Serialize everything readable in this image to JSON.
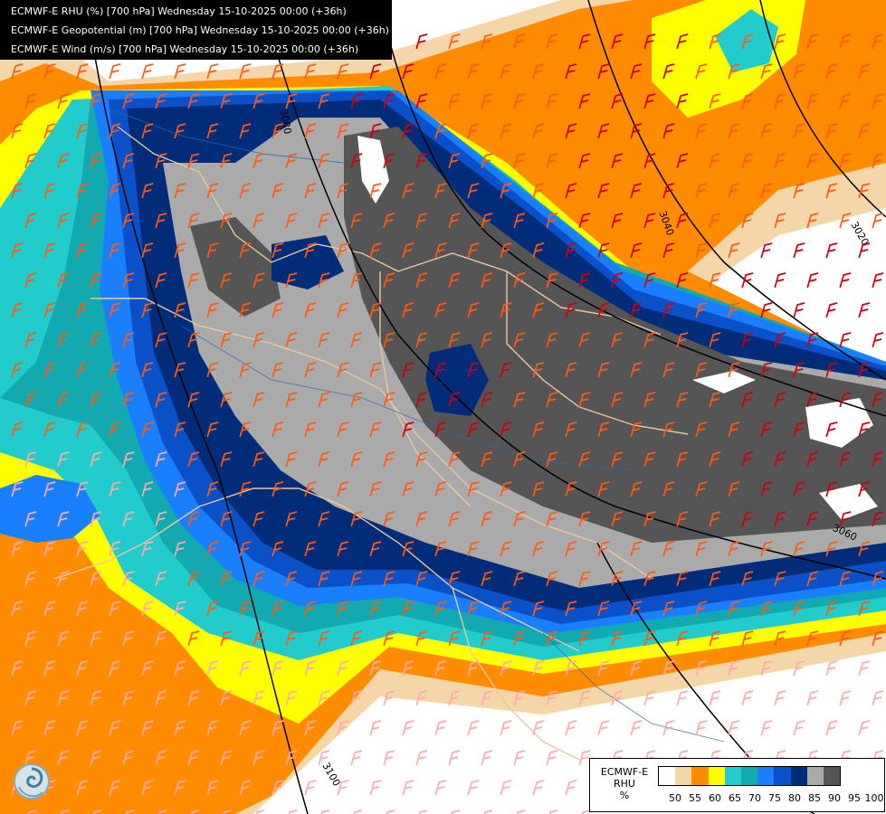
{
  "header": {
    "lines": [
      "ECMWF-E RHU (%) [700 hPa] Wednesday 15-10-2025 00:00 (+36h)",
      "ECMWF-E Geopotential (m) [700 hPa] Wednesday 15-10-2025 00:00 (+36h)",
      "ECMWF-E Wind (m/s) [700 hPa] Wednesday 15-10-2025 00:00 (+36h)"
    ]
  },
  "legend": {
    "model": "ECMWF-E",
    "variable": "RHU",
    "unit": "%",
    "colors": [
      "#ffffff",
      "#f5d6a8",
      "#ff8c00",
      "#ffff00",
      "#22cccc",
      "#10aab0",
      "#1a7fff",
      "#0a50c8",
      "#002c7a",
      "#aaaaaa",
      "#555555"
    ],
    "ticks": [
      "50",
      "55",
      "60",
      "65",
      "70",
      "75",
      "80",
      "85",
      "90",
      "95",
      "100"
    ]
  },
  "contours": {
    "labels": [
      "3080",
      "3040",
      "3020",
      "3060",
      "3100"
    ]
  },
  "logo": {
    "icon": "ecmwf-swirl-logo"
  },
  "colors": {
    "wind_barb_strong": "#cc0011",
    "wind_barb_medium": "#ff5a14",
    "wind_barb_light": "#ffaaaa",
    "borders": "#e8c8a0",
    "rivers": "#3366aa"
  }
}
